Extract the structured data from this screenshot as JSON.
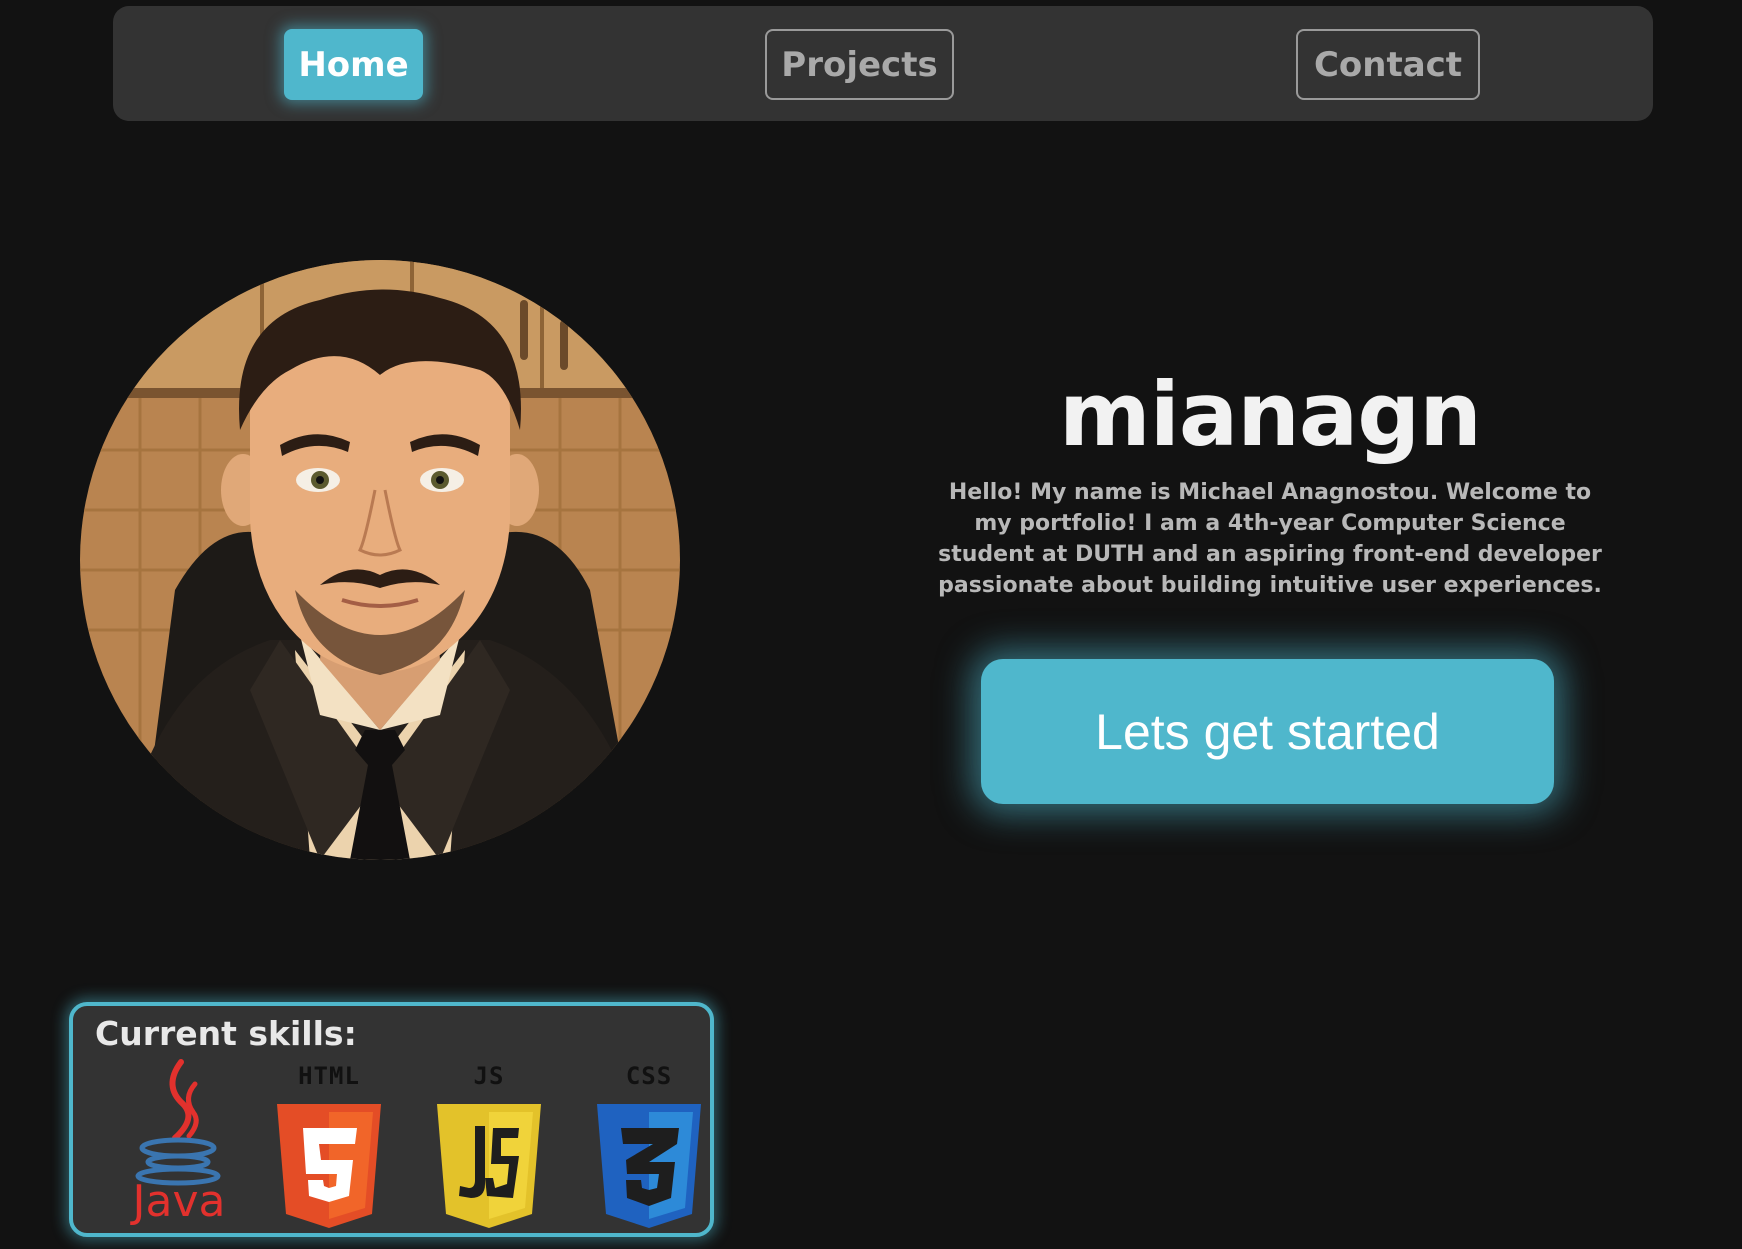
{
  "nav": {
    "items": [
      {
        "label": "Home",
        "active": true
      },
      {
        "label": "Projects",
        "active": false
      },
      {
        "label": "Contact",
        "active": false
      }
    ]
  },
  "hero": {
    "title": "mianagn",
    "description": "Hello! My name is Michael Anagnostou. Welcome to my portfolio! I am a 4th-year Computer Science student at DUTH and an aspiring front-end developer passionate about building intuitive user experiences.",
    "cta_label": "Lets get started"
  },
  "skills": {
    "title": "Current skills:",
    "items": [
      {
        "label": "Java",
        "icon": "java-icon"
      },
      {
        "label": "HTML",
        "icon": "html5-icon"
      },
      {
        "label": "JS",
        "icon": "js-icon"
      },
      {
        "label": "CSS",
        "icon": "css3-icon"
      }
    ]
  },
  "colors": {
    "accent": "#4fb7cc",
    "background": "#121212",
    "panel": "#333333"
  }
}
